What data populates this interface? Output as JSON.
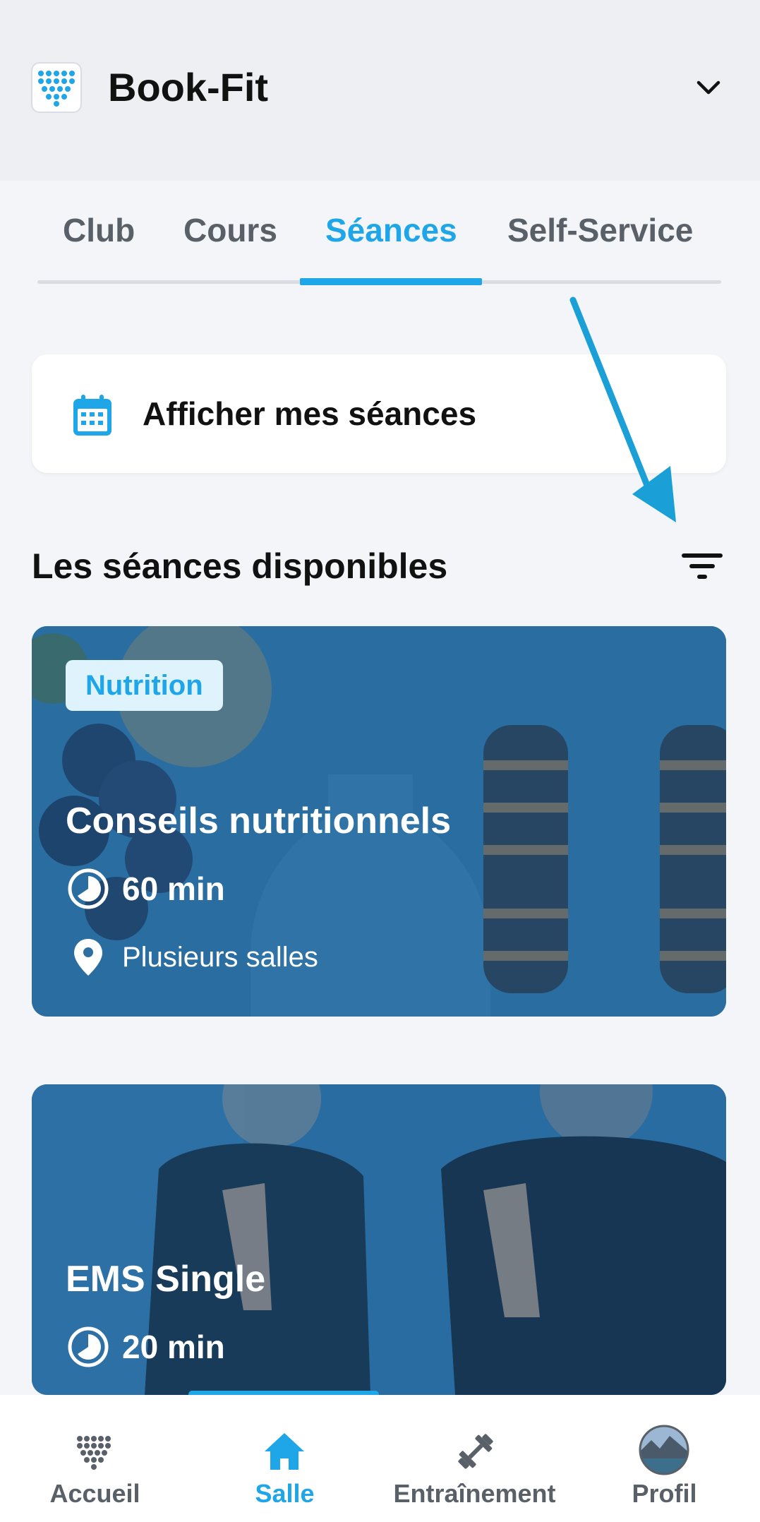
{
  "app": {
    "title": "Book-Fit"
  },
  "tabs": [
    {
      "label": "Club",
      "active": false
    },
    {
      "label": "Cours",
      "active": false
    },
    {
      "label": "Séances",
      "active": true
    },
    {
      "label": "Self-Service",
      "active": false
    }
  ],
  "my_sessions": {
    "label": "Afficher mes séances"
  },
  "section": {
    "title": "Les séances disponibles"
  },
  "sessions": [
    {
      "badge": "Nutrition",
      "title": "Conseils nutritionnels",
      "duration": "60 min",
      "location": "Plusieurs salles"
    },
    {
      "title": "EMS Single",
      "duration": "20 min"
    }
  ],
  "bottom_nav": [
    {
      "label": "Accueil",
      "icon": "dots-logo-icon",
      "active": false
    },
    {
      "label": "Salle",
      "icon": "home-icon",
      "active": true
    },
    {
      "label": "Entraînement",
      "icon": "dumbbell-icon",
      "active": false
    },
    {
      "label": "Profil",
      "icon": "avatar",
      "active": false
    }
  ],
  "colors": {
    "accent": "#1ea6e8",
    "header_bg": "#edeff2",
    "page_bg": "#f3f5f8"
  }
}
